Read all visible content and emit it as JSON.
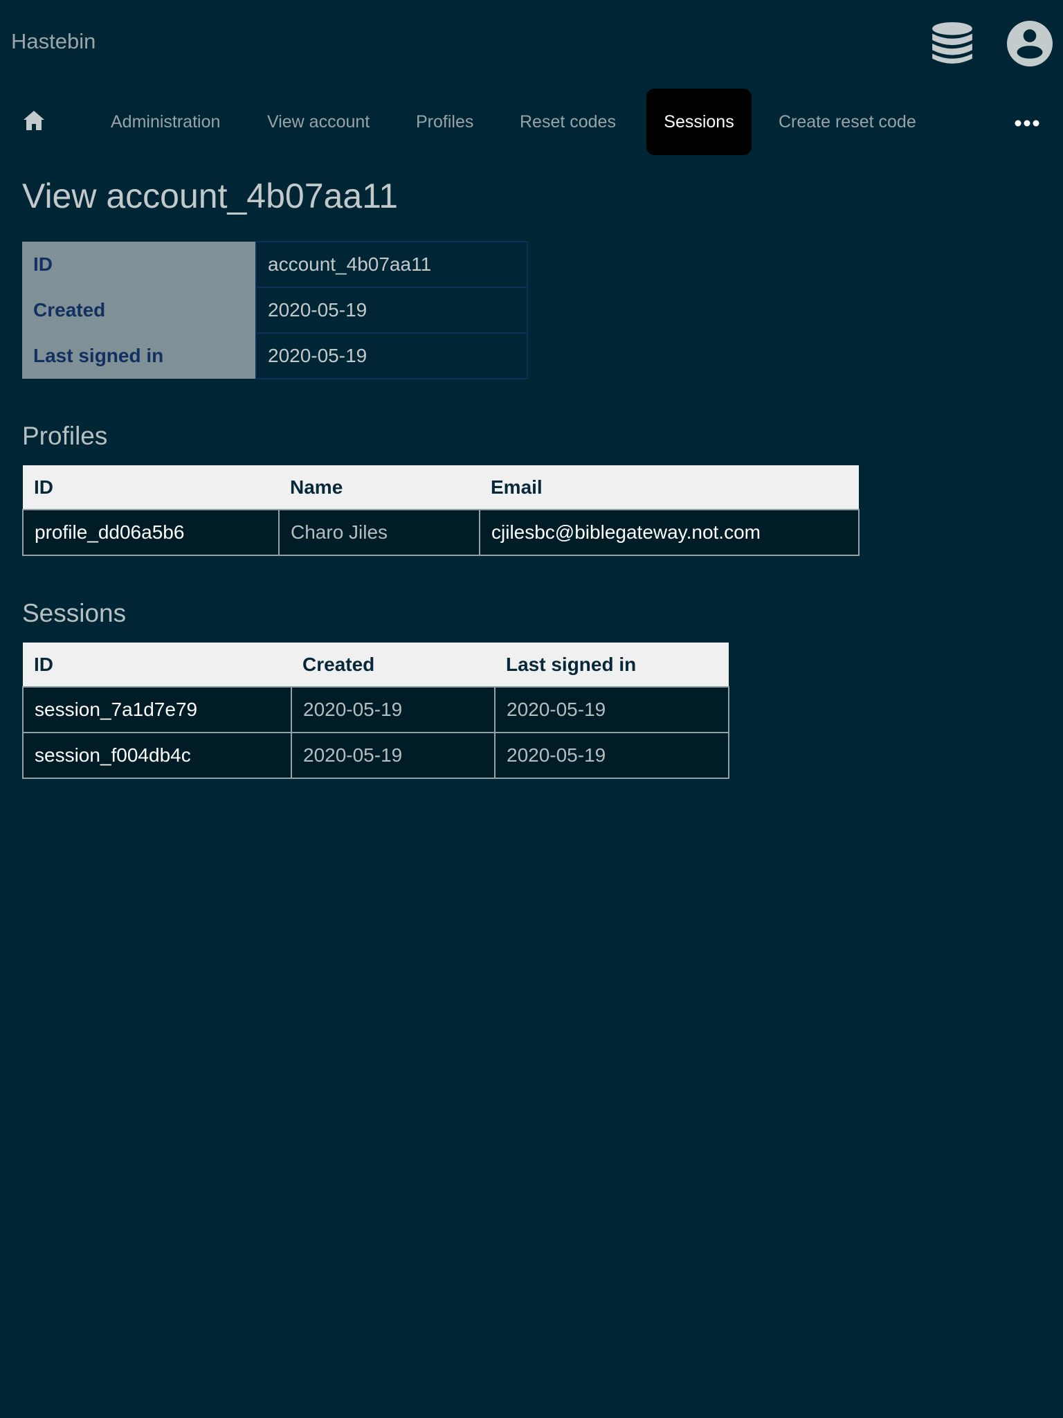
{
  "app": {
    "title": "Hastebin"
  },
  "header_icons": {
    "database": "database-icon",
    "user": "account-circle-icon"
  },
  "nav": {
    "home_icon": "home-icon",
    "more_icon": "more-horizontal-icon",
    "items": [
      {
        "label": "Administration",
        "active": false
      },
      {
        "label": "View account",
        "active": false
      },
      {
        "label": "Profiles",
        "active": false
      },
      {
        "label": "Reset codes",
        "active": false
      },
      {
        "label": "Sessions",
        "active": true
      },
      {
        "label": "Create reset code",
        "active": false
      }
    ]
  },
  "page": {
    "title": "View account_4b07aa11"
  },
  "account": {
    "rows": [
      {
        "label": "ID",
        "value": "account_4b07aa11"
      },
      {
        "label": "Created",
        "value": "2020-05-19"
      },
      {
        "label": "Last signed in",
        "value": "2020-05-19"
      }
    ]
  },
  "profiles": {
    "title": "Profiles",
    "columns": [
      "ID",
      "Name",
      "Email"
    ],
    "rows": [
      [
        "profile_dd06a5b6",
        "Charo Jiles",
        "cjilesbc@biblegateway.not.com"
      ]
    ]
  },
  "sessions": {
    "title": "Sessions",
    "columns": [
      "ID",
      "Created",
      "Last signed in"
    ],
    "rows": [
      [
        "session_7a1d7e79",
        "2020-05-19",
        "2020-05-19"
      ],
      [
        "session_f004db4c",
        "2020-05-19",
        "2020-05-19"
      ]
    ]
  },
  "colors": {
    "background": "#002636",
    "active_tab": "#000000",
    "kv_header": "#7f9097",
    "kv_label": "#12305f",
    "table_header": "#f0f0f0"
  }
}
